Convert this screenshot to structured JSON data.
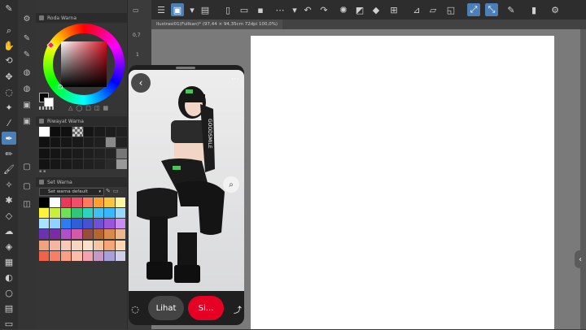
{
  "palette_labels": {
    "color_wheel": "Roda Warna",
    "intermediate": "Riwayat Warna",
    "color_set": "Set Warna",
    "set_dropdown": "Set warna default"
  },
  "document_tab": "Ilustrasi01(Fullkan)* (97,44 × 94,35cm 72dpi 100,0%)",
  "narrow_values": [
    "0,7",
    "1"
  ],
  "card": {
    "view_button": "Lihat",
    "save_button": "Si..."
  },
  "colors": {
    "accent": "#4c7fb5",
    "save_red": "#e60023"
  },
  "swatches": [
    "#000000",
    "#ffffff",
    "#e9395a",
    "#f04f6c",
    "#ff7b5e",
    "#ff9f2e",
    "#f9c440",
    "#fff5a0",
    "#fff23a",
    "#c7ef3b",
    "#6fe05a",
    "#2fc67a",
    "#2bd3c1",
    "#3ec1f0",
    "#38b6ff",
    "#9ad7ff",
    "#a6e3ff",
    "#8fd2ff",
    "#2c7df2",
    "#2f5fd6",
    "#4752d3",
    "#6d52d6",
    "#9b55d9",
    "#c98cf0",
    "#6b31b3",
    "#7d2aa8",
    "#b04fc7",
    "#d25aa8",
    "#9a4d3b",
    "#b8652d",
    "#d88a4a",
    "#e9b98c",
    "#f0a37f",
    "#f4b6a0",
    "#f7c9b8",
    "#f5d6c2",
    "#f9e0c8",
    "#f3c7a3",
    "#f6a77a",
    "#ffd7b5",
    "#f1624b",
    "#f57f67",
    "#f89f86",
    "#fbbcaa",
    "#f4a2b0",
    "#c798c3",
    "#a6a2d9",
    "#cfcfe8"
  ]
}
